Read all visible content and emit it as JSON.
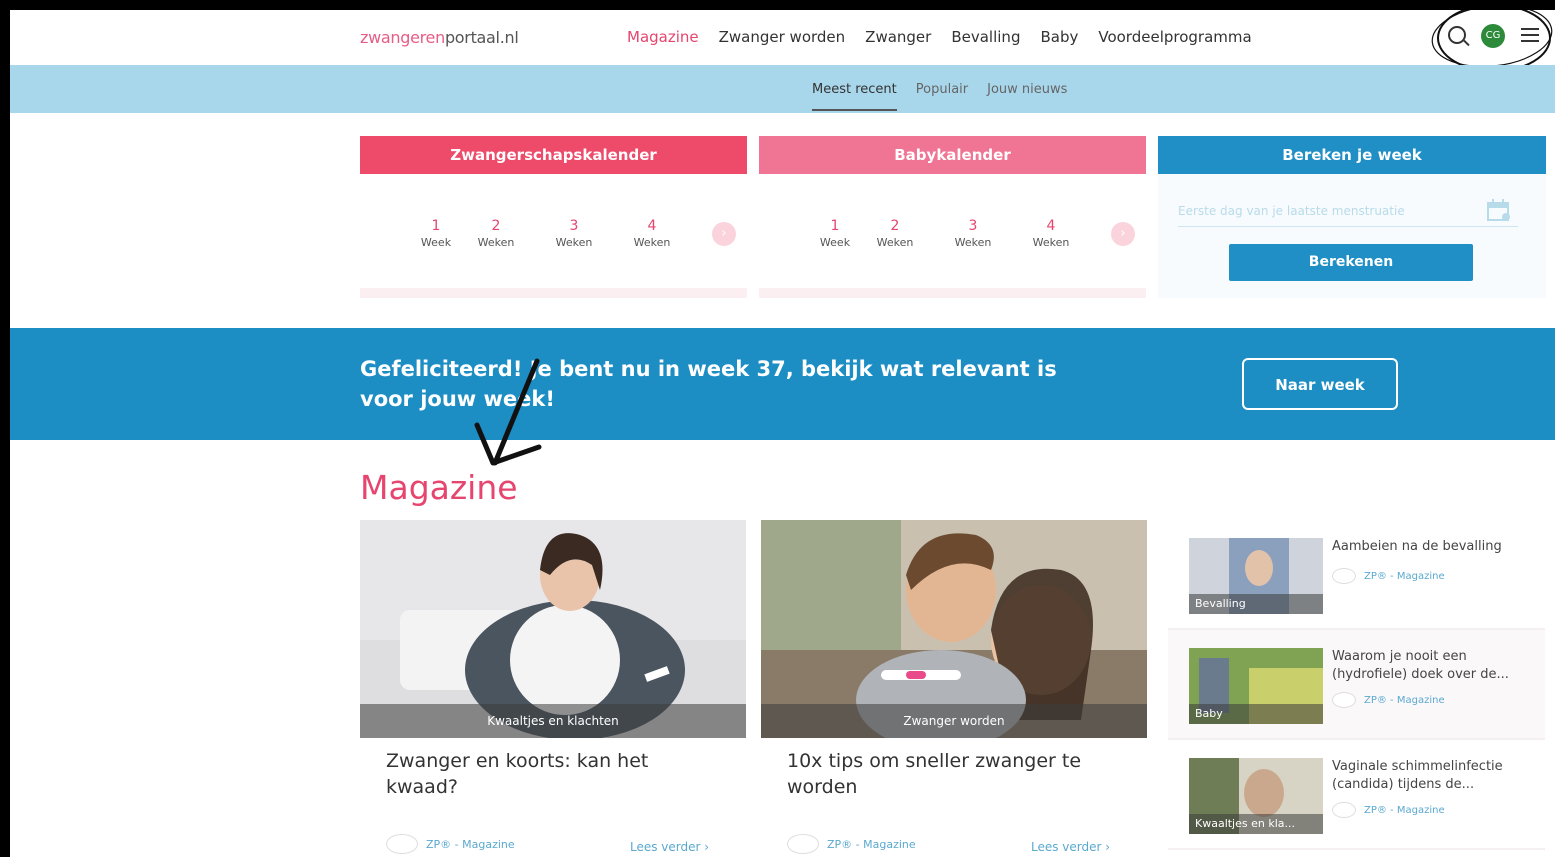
{
  "header": {
    "logo_part1": "zwangeren",
    "logo_part2": "portaal.nl",
    "nav": [
      "Magazine",
      "Zwanger worden",
      "Zwanger",
      "Bevalling",
      "Baby",
      "Voordeelprogramma"
    ],
    "avatar_initials": "CG"
  },
  "subnav": [
    "Meest recent",
    "Populair",
    "Jouw nieuws"
  ],
  "pregnancy_calendar": {
    "title": "Zwangerschapskalender",
    "weeks": [
      {
        "num": "1",
        "label": "Week"
      },
      {
        "num": "2",
        "label": "Weken"
      },
      {
        "num": "3",
        "label": "Weken"
      },
      {
        "num": "4",
        "label": "Weken"
      }
    ]
  },
  "baby_calendar": {
    "title": "Babykalender",
    "weeks": [
      {
        "num": "1",
        "label": "Week"
      },
      {
        "num": "2",
        "label": "Weken"
      },
      {
        "num": "3",
        "label": "Weken"
      },
      {
        "num": "4",
        "label": "Weken"
      }
    ]
  },
  "week_calculator": {
    "title": "Bereken je week",
    "placeholder": "Eerste dag van je laatste menstruatie",
    "button": "Berekenen"
  },
  "banner": {
    "text": "Gefeliciteerd! Je bent nu in week 37, bekijk wat relevant is voor jouw week!",
    "button": "Naar week"
  },
  "magazine": {
    "title": "Magazine",
    "articles": [
      {
        "category": "Kwaaltjes en klachten",
        "title": "Zwanger en koorts: kan het kwaad?",
        "source": "ZP® - Magazine",
        "read_more": "Lees verder"
      },
      {
        "category": "Zwanger worden",
        "title": "10x tips om sneller zwanger te worden",
        "source": "ZP® - Magazine",
        "read_more": "Lees verder"
      }
    ],
    "sidebar": [
      {
        "category": "Bevalling",
        "title": "Aambeien na de bevalling",
        "source": "ZP® - Magazine"
      },
      {
        "category": "Baby",
        "title": "Waarom je nooit een (hydrofiele) doek over de...",
        "source": "ZP® - Magazine"
      },
      {
        "category": "Kwaaltjes en kla...",
        "title": "Vaginale schimmelinfectie (candida) tijdens de...",
        "source": "ZP® - Magazine"
      }
    ]
  },
  "colors": {
    "pink": "#ee4a6a",
    "light_pink": "#f07493",
    "blue": "#1f8fc6",
    "subnav_blue": "#a8d6eb"
  }
}
